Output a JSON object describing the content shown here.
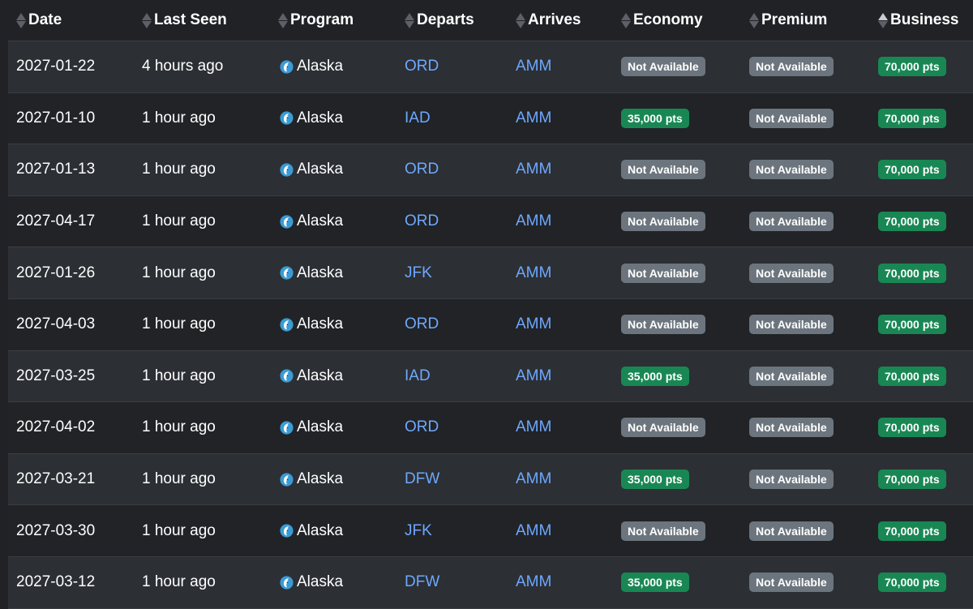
{
  "colors": {
    "link": "#6ea8fe",
    "available": "#198754",
    "unavailable": "#6c757d",
    "background": "#202226"
  },
  "columns": [
    {
      "label": "Date",
      "sort": "none"
    },
    {
      "label": "Last Seen",
      "sort": "none"
    },
    {
      "label": "Program",
      "sort": "none"
    },
    {
      "label": "Departs",
      "sort": "none"
    },
    {
      "label": "Arrives",
      "sort": "none"
    },
    {
      "label": "Economy",
      "sort": "none"
    },
    {
      "label": "Premium",
      "sort": "none"
    },
    {
      "label": "Business",
      "sort": "ascending"
    }
  ],
  "program_icon": "alaska-airlines-logo-icon",
  "rows": [
    {
      "date": "2027-01-22",
      "last_seen": "4 hours ago",
      "program": "Alaska",
      "departs": "ORD",
      "arrives": "AMM",
      "economy": "Not Available",
      "premium": "Not Available",
      "business": "70,000 pts"
    },
    {
      "date": "2027-01-10",
      "last_seen": "1 hour ago",
      "program": "Alaska",
      "departs": "IAD",
      "arrives": "AMM",
      "economy": "35,000 pts",
      "premium": "Not Available",
      "business": "70,000 pts"
    },
    {
      "date": "2027-01-13",
      "last_seen": "1 hour ago",
      "program": "Alaska",
      "departs": "ORD",
      "arrives": "AMM",
      "economy": "Not Available",
      "premium": "Not Available",
      "business": "70,000 pts"
    },
    {
      "date": "2027-04-17",
      "last_seen": "1 hour ago",
      "program": "Alaska",
      "departs": "ORD",
      "arrives": "AMM",
      "economy": "Not Available",
      "premium": "Not Available",
      "business": "70,000 pts"
    },
    {
      "date": "2027-01-26",
      "last_seen": "1 hour ago",
      "program": "Alaska",
      "departs": "JFK",
      "arrives": "AMM",
      "economy": "Not Available",
      "premium": "Not Available",
      "business": "70,000 pts"
    },
    {
      "date": "2027-04-03",
      "last_seen": "1 hour ago",
      "program": "Alaska",
      "departs": "ORD",
      "arrives": "AMM",
      "economy": "Not Available",
      "premium": "Not Available",
      "business": "70,000 pts"
    },
    {
      "date": "2027-03-25",
      "last_seen": "1 hour ago",
      "program": "Alaska",
      "departs": "IAD",
      "arrives": "AMM",
      "economy": "35,000 pts",
      "premium": "Not Available",
      "business": "70,000 pts"
    },
    {
      "date": "2027-04-02",
      "last_seen": "1 hour ago",
      "program": "Alaska",
      "departs": "ORD",
      "arrives": "AMM",
      "economy": "Not Available",
      "premium": "Not Available",
      "business": "70,000 pts"
    },
    {
      "date": "2027-03-21",
      "last_seen": "1 hour ago",
      "program": "Alaska",
      "departs": "DFW",
      "arrives": "AMM",
      "economy": "35,000 pts",
      "premium": "Not Available",
      "business": "70,000 pts"
    },
    {
      "date": "2027-03-30",
      "last_seen": "1 hour ago",
      "program": "Alaska",
      "departs": "JFK",
      "arrives": "AMM",
      "economy": "Not Available",
      "premium": "Not Available",
      "business": "70,000 pts"
    },
    {
      "date": "2027-03-12",
      "last_seen": "1 hour ago",
      "program": "Alaska",
      "departs": "DFW",
      "arrives": "AMM",
      "economy": "35,000 pts",
      "premium": "Not Available",
      "business": "70,000 pts"
    }
  ]
}
